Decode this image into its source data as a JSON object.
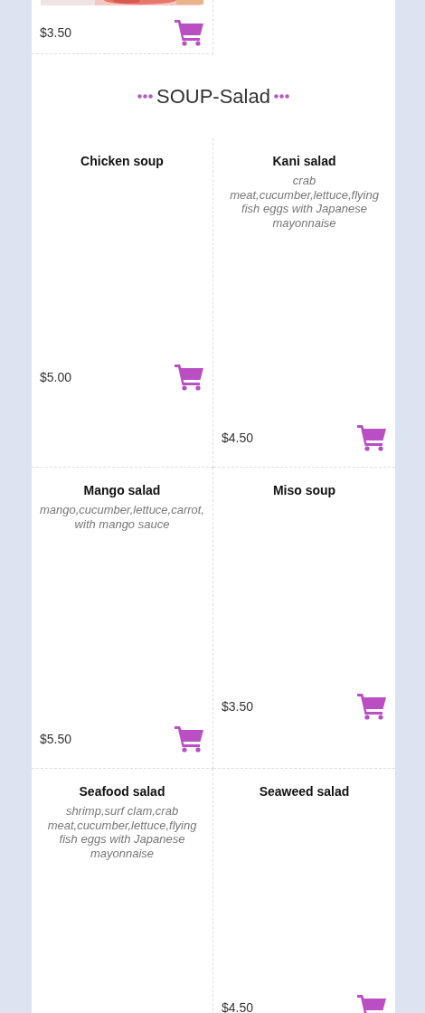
{
  "top_item": {
    "price": "$3.50"
  },
  "section": {
    "title": "SOUP-Salad"
  },
  "items": [
    {
      "name": "Chicken soup",
      "price": "$5.00"
    },
    {
      "name": "Kani salad",
      "description": "crab meat,cucumber,lettuce,flying fish eggs with Japanese mayonnaise",
      "price": "$4.50"
    },
    {
      "name": "Mango salad",
      "description": "mango,cucumber,lettuce,carrot, with mango sauce",
      "price": "$5.50"
    },
    {
      "name": "Miso soup",
      "price": "$3.50"
    },
    {
      "name": "Seafood salad",
      "description": "shrimp,surf clam,crab meat,cucumber,lettuce,flying fish eggs with Japanese mayonnaise"
    },
    {
      "name": "Seaweed salad",
      "price": "$4.50"
    }
  ]
}
